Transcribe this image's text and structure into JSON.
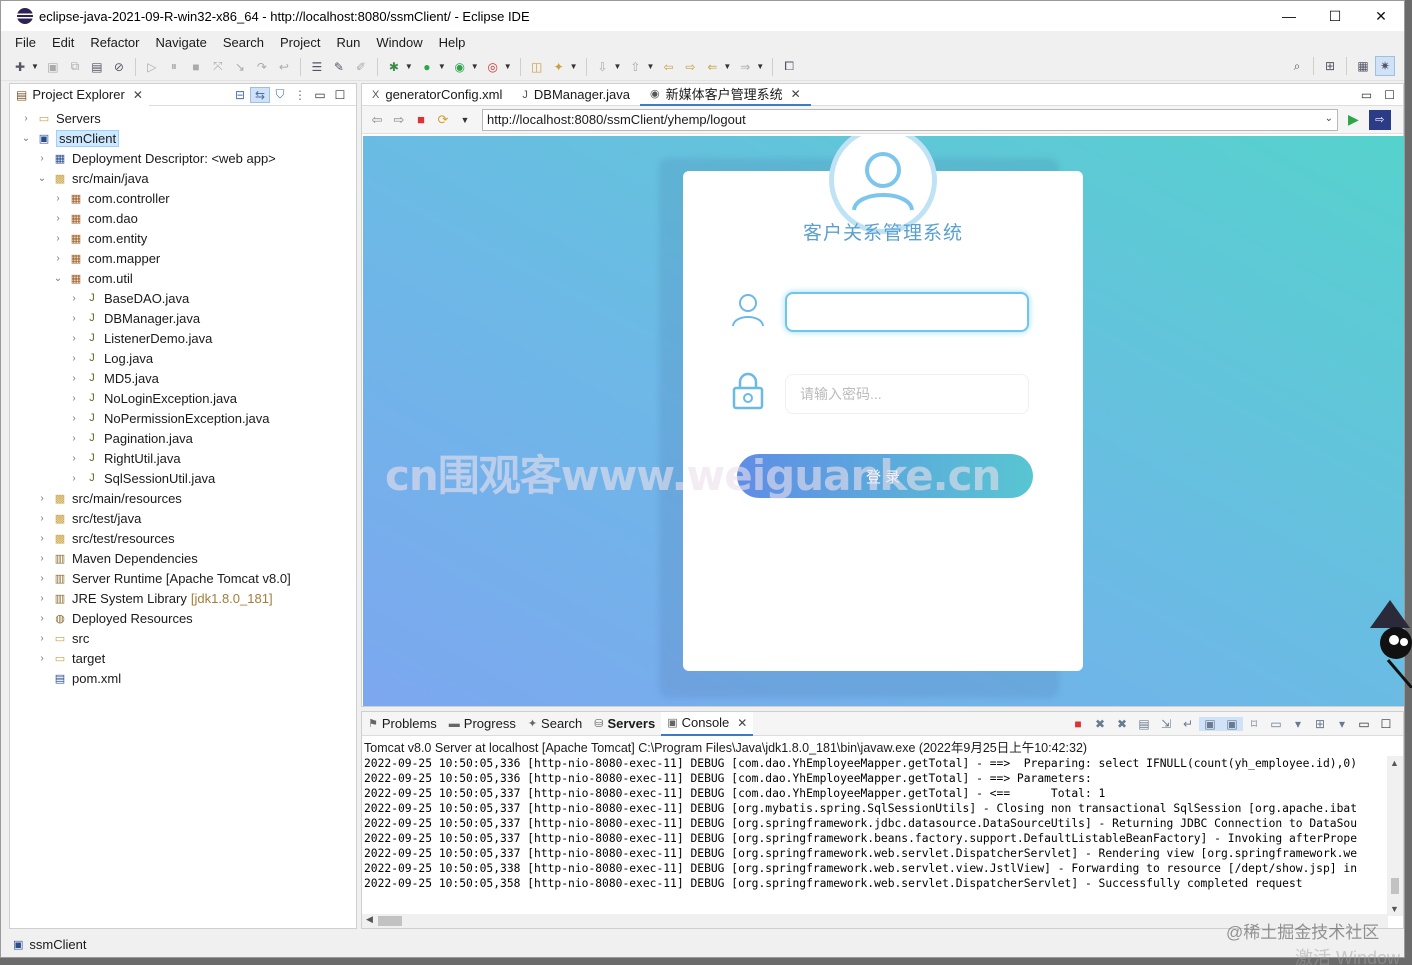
{
  "window": {
    "title": "eclipse-java-2021-09-R-win32-x86_64 - http://localhost:8080/ssmClient/ - Eclipse IDE",
    "minimize": "—",
    "maximize": "☐",
    "close": "✕"
  },
  "menu": [
    "File",
    "Edit",
    "Refactor",
    "Navigate",
    "Search",
    "Project",
    "Run",
    "Window",
    "Help"
  ],
  "project_explorer": {
    "tab_label": "Project Explorer",
    "items": [
      {
        "label": "Servers",
        "level": 0,
        "expanded": false,
        "icon": "folder-icon"
      },
      {
        "label": "ssmClient",
        "level": 0,
        "expanded": true,
        "icon": "project-icon",
        "selected": true
      },
      {
        "label": "Deployment Descriptor: <web app>",
        "level": 1,
        "expanded": false,
        "icon": "descriptor-icon"
      },
      {
        "label": "src/main/java",
        "level": 1,
        "expanded": true,
        "icon": "source-folder-icon"
      },
      {
        "label": "com.controller",
        "level": 2,
        "expanded": false,
        "icon": "package-icon"
      },
      {
        "label": "com.dao",
        "level": 2,
        "expanded": false,
        "icon": "package-icon"
      },
      {
        "label": "com.entity",
        "level": 2,
        "expanded": false,
        "icon": "package-icon"
      },
      {
        "label": "com.mapper",
        "level": 2,
        "expanded": false,
        "icon": "package-icon"
      },
      {
        "label": "com.util",
        "level": 2,
        "expanded": true,
        "icon": "package-icon"
      },
      {
        "label": "BaseDAO.java",
        "level": 3,
        "expanded": false,
        "icon": "java-file-icon"
      },
      {
        "label": "DBManager.java",
        "level": 3,
        "expanded": false,
        "icon": "java-file-icon"
      },
      {
        "label": "ListenerDemo.java",
        "level": 3,
        "expanded": false,
        "icon": "java-file-icon"
      },
      {
        "label": "Log.java",
        "level": 3,
        "expanded": false,
        "icon": "java-file-icon"
      },
      {
        "label": "MD5.java",
        "level": 3,
        "expanded": false,
        "icon": "java-file-icon"
      },
      {
        "label": "NoLoginException.java",
        "level": 3,
        "expanded": false,
        "icon": "java-file-icon"
      },
      {
        "label": "NoPermissionException.java",
        "level": 3,
        "expanded": false,
        "icon": "java-file-icon"
      },
      {
        "label": "Pagination.java",
        "level": 3,
        "expanded": false,
        "icon": "java-file-icon"
      },
      {
        "label": "RightUtil.java",
        "level": 3,
        "expanded": false,
        "icon": "java-file-icon"
      },
      {
        "label": "SqlSessionUtil.java",
        "level": 3,
        "expanded": false,
        "icon": "java-file-icon"
      },
      {
        "label": "src/main/resources",
        "level": 1,
        "expanded": false,
        "icon": "source-folder-icon"
      },
      {
        "label": "src/test/java",
        "level": 1,
        "expanded": false,
        "icon": "source-folder-icon"
      },
      {
        "label": "src/test/resources",
        "level": 1,
        "expanded": false,
        "icon": "source-folder-icon"
      },
      {
        "label": "Maven Dependencies",
        "level": 1,
        "expanded": false,
        "icon": "library-icon"
      },
      {
        "label": "Server Runtime [Apache Tomcat v8.0]",
        "level": 1,
        "expanded": false,
        "icon": "library-icon"
      },
      {
        "label": "JRE System Library",
        "decoration": "[jdk1.8.0_181]",
        "level": 1,
        "expanded": false,
        "icon": "library-icon"
      },
      {
        "label": "Deployed Resources",
        "level": 1,
        "expanded": false,
        "icon": "deployed-icon"
      },
      {
        "label": "src",
        "level": 1,
        "expanded": false,
        "icon": "folder-icon"
      },
      {
        "label": "target",
        "level": 1,
        "expanded": false,
        "icon": "folder-icon"
      },
      {
        "label": "pom.xml",
        "level": 1,
        "expanded": null,
        "icon": "xml-file-icon"
      }
    ]
  },
  "editor": {
    "tabs": [
      {
        "label": "generatorConfig.xml",
        "icon": "xml-file-icon"
      },
      {
        "label": "DBManager.java",
        "icon": "java-file-icon"
      },
      {
        "label": "新媒体客户管理系统",
        "icon": "globe-icon",
        "active": true
      }
    ],
    "url": "http://localhost:8080/ssmClient/yhemp/logout"
  },
  "webpage": {
    "title": "客户关系管理系统",
    "username_value": "",
    "password_placeholder": "请输入密码...",
    "login_label": "登录",
    "watermark": "cn围观客www.weiguanke.cn"
  },
  "bottom_panel": {
    "tabs": [
      {
        "label": "Problems",
        "icon": "problems-icon"
      },
      {
        "label": "Progress",
        "icon": "progress-icon"
      },
      {
        "label": "Search",
        "icon": "search-icon"
      },
      {
        "label": "Servers",
        "icon": "servers-icon",
        "bold": true
      },
      {
        "label": "Console",
        "icon": "console-icon",
        "active": true
      }
    ],
    "console_title": "Tomcat v8.0 Server at localhost [Apache Tomcat] C:\\Program Files\\Java\\jdk1.8.0_181\\bin\\javaw.exe  (2022年9月25日上午10:42:32)",
    "lines": [
      "2022-09-25 10:50:05,336 [http-nio-8080-exec-11] DEBUG [com.dao.YhEmployeeMapper.getTotal] - ==>  Preparing: select IFNULL(count(yh_employee.id),0)",
      "2022-09-25 10:50:05,336 [http-nio-8080-exec-11] DEBUG [com.dao.YhEmployeeMapper.getTotal] - ==> Parameters: ",
      "2022-09-25 10:50:05,337 [http-nio-8080-exec-11] DEBUG [com.dao.YhEmployeeMapper.getTotal] - <==      Total: 1",
      "2022-09-25 10:50:05,337 [http-nio-8080-exec-11] DEBUG [org.mybatis.spring.SqlSessionUtils] - Closing non transactional SqlSession [org.apache.ibat",
      "2022-09-25 10:50:05,337 [http-nio-8080-exec-11] DEBUG [org.springframework.jdbc.datasource.DataSourceUtils] - Returning JDBC Connection to DataSou",
      "2022-09-25 10:50:05,337 [http-nio-8080-exec-11] DEBUG [org.springframework.beans.factory.support.DefaultListableBeanFactory] - Invoking afterPrope",
      "2022-09-25 10:50:05,337 [http-nio-8080-exec-11] DEBUG [org.springframework.web.servlet.DispatcherServlet] - Rendering view [org.springframework.we",
      "2022-09-25 10:50:05,338 [http-nio-8080-exec-11] DEBUG [org.springframework.web.servlet.view.JstlView] - Forwarding to resource [/dept/show.jsp] in",
      "2022-09-25 10:50:05,358 [http-nio-8080-exec-11] DEBUG [org.springframework.web.servlet.DispatcherServlet] - Successfully completed request"
    ]
  },
  "statusbar": {
    "label": "ssmClient"
  },
  "overlay": {
    "juejin_watermark": "@稀土掘金技术社区",
    "activate_watermark": "激活 Window"
  },
  "colors": {
    "accent": "#3d7bc4",
    "gradient_start": "#7da7f0",
    "gradient_end": "#56d2cd",
    "login_title": "#5aa0cf"
  }
}
